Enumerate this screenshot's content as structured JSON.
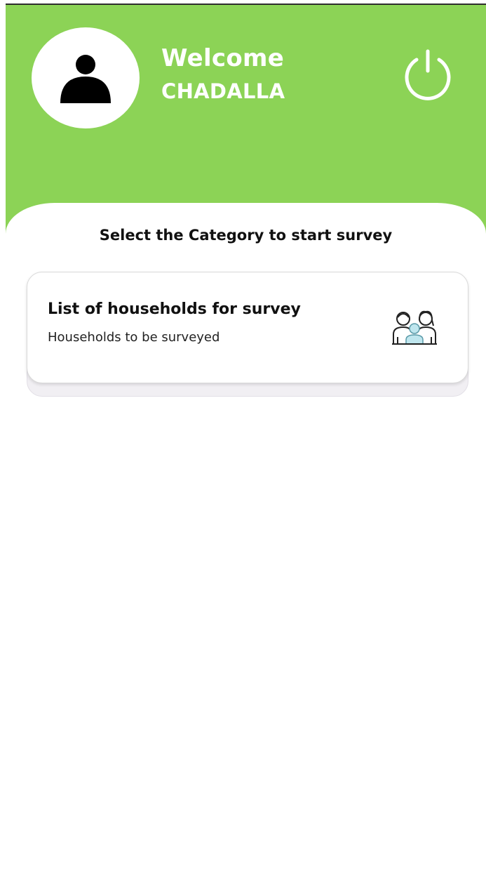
{
  "header": {
    "greeting": "Welcome",
    "user_name": "CHADALLA",
    "background_color": "#8cd356",
    "avatar_icon": "user-icon",
    "logout_icon": "power-icon"
  },
  "main": {
    "section_title": "Select the Category to start survey",
    "categories": [
      {
        "title": "List of households for survey",
        "subtitle": "Households to be surveyed",
        "icon": "family-icon"
      }
    ]
  }
}
